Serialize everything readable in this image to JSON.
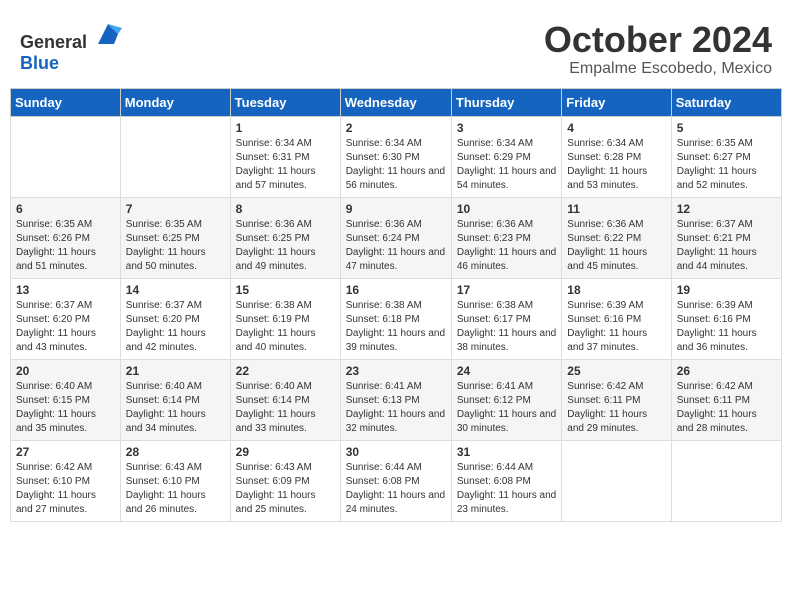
{
  "header": {
    "logo_general": "General",
    "logo_blue": "Blue",
    "month_year": "October 2024",
    "location": "Empalme Escobedo, Mexico"
  },
  "days_of_week": [
    "Sunday",
    "Monday",
    "Tuesday",
    "Wednesday",
    "Thursday",
    "Friday",
    "Saturday"
  ],
  "weeks": [
    [
      {
        "day": "",
        "info": ""
      },
      {
        "day": "",
        "info": ""
      },
      {
        "day": "1",
        "info": "Sunrise: 6:34 AM\nSunset: 6:31 PM\nDaylight: 11 hours and 57 minutes."
      },
      {
        "day": "2",
        "info": "Sunrise: 6:34 AM\nSunset: 6:30 PM\nDaylight: 11 hours and 56 minutes."
      },
      {
        "day": "3",
        "info": "Sunrise: 6:34 AM\nSunset: 6:29 PM\nDaylight: 11 hours and 54 minutes."
      },
      {
        "day": "4",
        "info": "Sunrise: 6:34 AM\nSunset: 6:28 PM\nDaylight: 11 hours and 53 minutes."
      },
      {
        "day": "5",
        "info": "Sunrise: 6:35 AM\nSunset: 6:27 PM\nDaylight: 11 hours and 52 minutes."
      }
    ],
    [
      {
        "day": "6",
        "info": "Sunrise: 6:35 AM\nSunset: 6:26 PM\nDaylight: 11 hours and 51 minutes."
      },
      {
        "day": "7",
        "info": "Sunrise: 6:35 AM\nSunset: 6:25 PM\nDaylight: 11 hours and 50 minutes."
      },
      {
        "day": "8",
        "info": "Sunrise: 6:36 AM\nSunset: 6:25 PM\nDaylight: 11 hours and 49 minutes."
      },
      {
        "day": "9",
        "info": "Sunrise: 6:36 AM\nSunset: 6:24 PM\nDaylight: 11 hours and 47 minutes."
      },
      {
        "day": "10",
        "info": "Sunrise: 6:36 AM\nSunset: 6:23 PM\nDaylight: 11 hours and 46 minutes."
      },
      {
        "day": "11",
        "info": "Sunrise: 6:36 AM\nSunset: 6:22 PM\nDaylight: 11 hours and 45 minutes."
      },
      {
        "day": "12",
        "info": "Sunrise: 6:37 AM\nSunset: 6:21 PM\nDaylight: 11 hours and 44 minutes."
      }
    ],
    [
      {
        "day": "13",
        "info": "Sunrise: 6:37 AM\nSunset: 6:20 PM\nDaylight: 11 hours and 43 minutes."
      },
      {
        "day": "14",
        "info": "Sunrise: 6:37 AM\nSunset: 6:20 PM\nDaylight: 11 hours and 42 minutes."
      },
      {
        "day": "15",
        "info": "Sunrise: 6:38 AM\nSunset: 6:19 PM\nDaylight: 11 hours and 40 minutes."
      },
      {
        "day": "16",
        "info": "Sunrise: 6:38 AM\nSunset: 6:18 PM\nDaylight: 11 hours and 39 minutes."
      },
      {
        "day": "17",
        "info": "Sunrise: 6:38 AM\nSunset: 6:17 PM\nDaylight: 11 hours and 38 minutes."
      },
      {
        "day": "18",
        "info": "Sunrise: 6:39 AM\nSunset: 6:16 PM\nDaylight: 11 hours and 37 minutes."
      },
      {
        "day": "19",
        "info": "Sunrise: 6:39 AM\nSunset: 6:16 PM\nDaylight: 11 hours and 36 minutes."
      }
    ],
    [
      {
        "day": "20",
        "info": "Sunrise: 6:40 AM\nSunset: 6:15 PM\nDaylight: 11 hours and 35 minutes."
      },
      {
        "day": "21",
        "info": "Sunrise: 6:40 AM\nSunset: 6:14 PM\nDaylight: 11 hours and 34 minutes."
      },
      {
        "day": "22",
        "info": "Sunrise: 6:40 AM\nSunset: 6:14 PM\nDaylight: 11 hours and 33 minutes."
      },
      {
        "day": "23",
        "info": "Sunrise: 6:41 AM\nSunset: 6:13 PM\nDaylight: 11 hours and 32 minutes."
      },
      {
        "day": "24",
        "info": "Sunrise: 6:41 AM\nSunset: 6:12 PM\nDaylight: 11 hours and 30 minutes."
      },
      {
        "day": "25",
        "info": "Sunrise: 6:42 AM\nSunset: 6:11 PM\nDaylight: 11 hours and 29 minutes."
      },
      {
        "day": "26",
        "info": "Sunrise: 6:42 AM\nSunset: 6:11 PM\nDaylight: 11 hours and 28 minutes."
      }
    ],
    [
      {
        "day": "27",
        "info": "Sunrise: 6:42 AM\nSunset: 6:10 PM\nDaylight: 11 hours and 27 minutes."
      },
      {
        "day": "28",
        "info": "Sunrise: 6:43 AM\nSunset: 6:10 PM\nDaylight: 11 hours and 26 minutes."
      },
      {
        "day": "29",
        "info": "Sunrise: 6:43 AM\nSunset: 6:09 PM\nDaylight: 11 hours and 25 minutes."
      },
      {
        "day": "30",
        "info": "Sunrise: 6:44 AM\nSunset: 6:08 PM\nDaylight: 11 hours and 24 minutes."
      },
      {
        "day": "31",
        "info": "Sunrise: 6:44 AM\nSunset: 6:08 PM\nDaylight: 11 hours and 23 minutes."
      },
      {
        "day": "",
        "info": ""
      },
      {
        "day": "",
        "info": ""
      }
    ]
  ]
}
